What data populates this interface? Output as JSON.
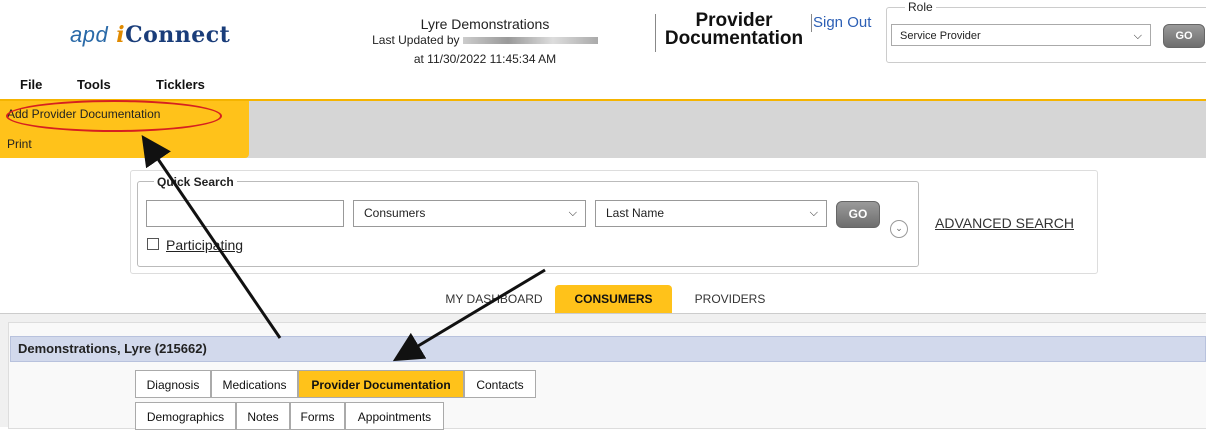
{
  "header": {
    "logo_prefix": "apd",
    "logo_i": "i",
    "logo_rest": "Connect",
    "org_name": "Lyre Demonstrations",
    "last_updated_by_label": "Last Updated by",
    "last_updated_at": "at 11/30/2022 11:45:34 AM",
    "page_title_line1": "Provider",
    "page_title_line2": "Documentation",
    "sign_out": "Sign Out",
    "role_label": "Role",
    "role_value": "Service Provider",
    "role_go": "GO"
  },
  "menu": {
    "file": "File",
    "tools": "Tools",
    "ticklers": "Ticklers"
  },
  "dropdown": {
    "add": "Add Provider Documentation",
    "print": "Print"
  },
  "quick_search": {
    "legend": "Quick Search",
    "type_value": "Consumers",
    "field_value": "Last Name",
    "go": "GO",
    "advanced": "ADVANCED SEARCH",
    "participating": "Participating"
  },
  "nav_tabs": {
    "dashboard": "MY DASHBOARD",
    "consumers": "CONSUMERS",
    "providers": "PROVIDERS"
  },
  "consumer": {
    "name": "Demonstrations, Lyre (215662)"
  },
  "sub_tabs": {
    "diagnosis": "Diagnosis",
    "medications": "Medications",
    "provider_documentation": "Provider Documentation",
    "contacts": "Contacts",
    "demographics": "Demographics",
    "notes": "Notes",
    "forms": "Forms",
    "appointments": "Appointments"
  },
  "colors": {
    "accent_gold": "#ffc21a",
    "annotation_red": "#d62020",
    "link_blue": "#2c5fb5"
  },
  "icons": {
    "chevron": "chevron-down-icon",
    "expand": "expand-circle-icon"
  }
}
